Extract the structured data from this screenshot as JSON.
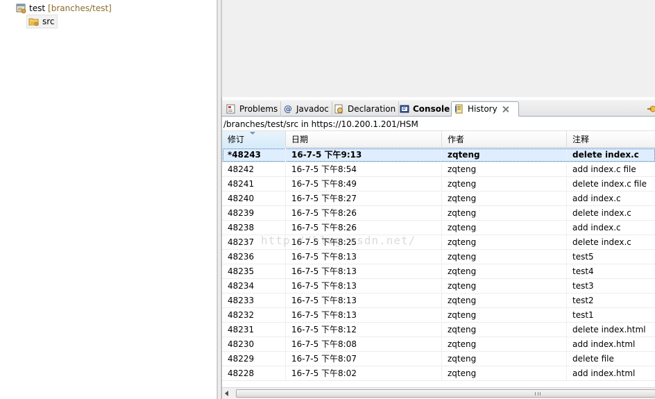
{
  "tree": {
    "project": {
      "name": "test",
      "branch": "[branches/test]",
      "icon": "svn-project-icon"
    },
    "folder": {
      "name": "src",
      "icon": "svn-folder-icon"
    }
  },
  "view": {
    "tabs": [
      {
        "label": "Problems",
        "icon": "problems-icon"
      },
      {
        "label": "Javadoc",
        "icon": "at-icon"
      },
      {
        "label": "Declaration",
        "icon": "declaration-icon"
      },
      {
        "label": "Console",
        "icon": "console-icon"
      },
      {
        "label": "History",
        "icon": "history-icon"
      }
    ],
    "path": "/branches/test/src in https://10.200.1.201/HSM",
    "watermark": "http://blog.csdn.net/"
  },
  "table": {
    "columns": [
      "修订",
      "日期",
      "作者",
      "注释"
    ],
    "rows": [
      [
        "*48243",
        "16-7-5 下午9:13",
        "zqteng",
        "delete index.c"
      ],
      [
        "48242",
        "16-7-5 下午8:54",
        "zqteng",
        "add index.c file"
      ],
      [
        "48241",
        "16-7-5 下午8:49",
        "zqteng",
        "delete index.c file"
      ],
      [
        "48240",
        "16-7-5 下午8:27",
        "zqteng",
        "add index.c"
      ],
      [
        "48239",
        "16-7-5 下午8:26",
        "zqteng",
        "delete index.c"
      ],
      [
        "48238",
        "16-7-5 下午8:26",
        "zqteng",
        "add index.c"
      ],
      [
        "48237",
        "16-7-5 下午8:25",
        "zqteng",
        "delete index.c"
      ],
      [
        "48236",
        "16-7-5 下午8:13",
        "zqteng",
        "test5"
      ],
      [
        "48235",
        "16-7-5 下午8:13",
        "zqteng",
        "test4"
      ],
      [
        "48234",
        "16-7-5 下午8:13",
        "zqteng",
        "test3"
      ],
      [
        "48233",
        "16-7-5 下午8:13",
        "zqteng",
        "test2"
      ],
      [
        "48232",
        "16-7-5 下午8:13",
        "zqteng",
        "test1"
      ],
      [
        "48231",
        "16-7-5 下午8:12",
        "zqteng",
        "delete index.html"
      ],
      [
        "48230",
        "16-7-5 下午8:08",
        "zqteng",
        "add index.html"
      ],
      [
        "48229",
        "16-7-5 下午8:07",
        "zqteng",
        "delete file"
      ],
      [
        "48228",
        "16-7-5 下午8:02",
        "zqteng",
        "add index.html"
      ]
    ],
    "selected_index": 0
  },
  "colors": {
    "selection": "#dfeeff",
    "tab_border": "#9daac0",
    "branch_text": "#8a6c2b"
  }
}
